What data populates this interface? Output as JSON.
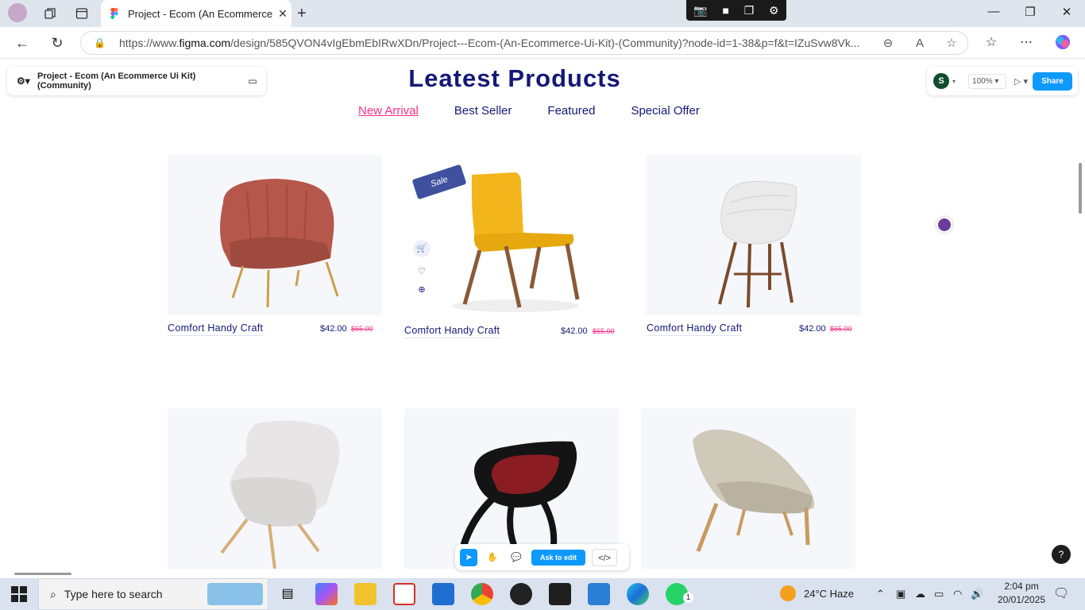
{
  "browser": {
    "tab_title": "Project - Ecom (An Ecommerce Ui",
    "url_prefix": "https://www.",
    "url_domain": "figma.com",
    "url_rest": "/design/585QVON4vIgEbmEbIRwXDn/Project---Ecom-(An-Ecommerce-Ui-Kit)-(Community)?node-id=1-38&p=f&t=IZuSvw8Vk..."
  },
  "figma": {
    "project_title": "Project - Ecom (An Ecommerce Ui Kit) (Community)",
    "avatar_letter": "S",
    "zoom": "100%",
    "share_label": "Share",
    "ask_label": "Ask to edit",
    "help_label": "?"
  },
  "page": {
    "heading": "Leatest Products",
    "filters": [
      "New Arrival",
      "Best Seller",
      "Featured",
      "Special Offer"
    ],
    "active_filter": "New Arrival",
    "sale_badge": "Sale",
    "products": [
      {
        "name": "Comfort Handy Craft",
        "price": "$42.00",
        "old_price": "$65.00",
        "chair": "pink-armchair"
      },
      {
        "name": "Comfort Handy Craft",
        "price": "$42.00",
        "old_price": "$65.00",
        "chair": "yellow-chair"
      },
      {
        "name": "Comfort Handy Craft",
        "price": "$42.00",
        "old_price": "$65.00",
        "chair": "white-chair"
      },
      {
        "chair": "grey-wingback-chair"
      },
      {
        "chair": "black-red-chair"
      },
      {
        "chair": "beige-lounge-chair"
      }
    ]
  },
  "taskbar": {
    "search_placeholder": "Type here to search",
    "weather": "24°C  Haze",
    "time": "2:04 pm",
    "date": "20/01/2025",
    "whatsapp_badge": "1"
  },
  "colors": {
    "navy": "#151875",
    "pink": "#fb2e86",
    "figma_blue": "#0d99ff",
    "sale_blue": "#3f509e"
  }
}
